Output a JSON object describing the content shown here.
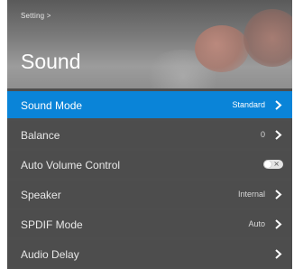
{
  "header": {
    "breadcrumb": "Setting >",
    "title": "Sound"
  },
  "colors": {
    "selected_row": "#0a84d8",
    "row_background": "#4d4d4d"
  },
  "menu": [
    {
      "label": "Sound Mode",
      "value": "Standard",
      "control": "chevron",
      "selected": true
    },
    {
      "label": "Balance",
      "value": "0",
      "control": "chevron",
      "selected": false
    },
    {
      "label": "Auto Volume Control",
      "value": "",
      "control": "toggle",
      "toggle_state": "off",
      "toggle_glyph": "×",
      "selected": false
    },
    {
      "label": "Speaker",
      "value": "Internal",
      "control": "chevron",
      "selected": false
    },
    {
      "label": "SPDIF Mode",
      "value": "Auto",
      "control": "chevron",
      "selected": false
    },
    {
      "label": "Audio Delay",
      "value": "",
      "control": "chevron",
      "selected": false
    }
  ]
}
